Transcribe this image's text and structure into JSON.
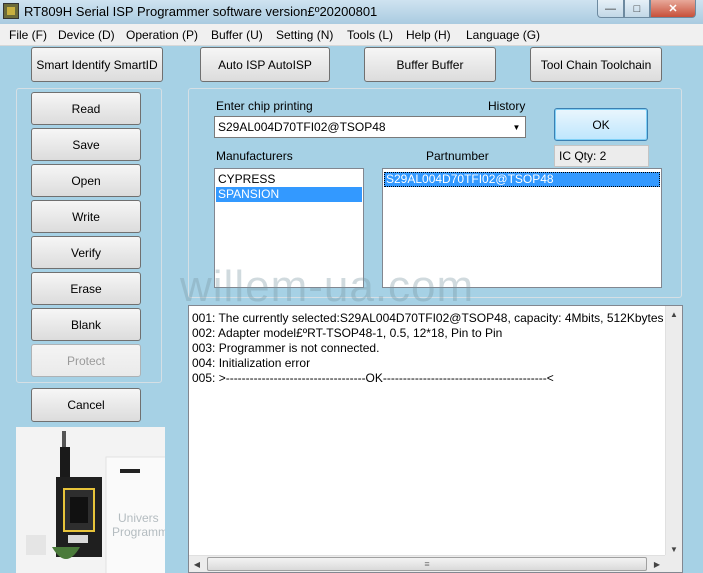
{
  "window": {
    "title": "RT809H Serial ISP Programmer software version£º20200801",
    "controls": {
      "minimize": "—",
      "maximize": "□",
      "close": "✕"
    }
  },
  "menu": [
    {
      "label": "File (F)"
    },
    {
      "label": "Device (D)"
    },
    {
      "label": "Operation (P)"
    },
    {
      "label": "Buffer (U)"
    },
    {
      "label": "Setting (N)"
    },
    {
      "label": "Tools (L)"
    },
    {
      "label": "Help (H)"
    },
    {
      "label": "Language (G)"
    }
  ],
  "toolbar": {
    "smart_identify": "Smart Identify SmartID",
    "auto_isp": "Auto ISP AutoISP",
    "buffer": "Buffer Buffer",
    "tool_chain": "Tool Chain Toolchain"
  },
  "operations": {
    "read": "Read",
    "save": "Save",
    "open": "Open",
    "write": "Write",
    "verify": "Verify",
    "erase": "Erase",
    "blank": "Blank",
    "protect": "Protect",
    "cancel": "Cancel"
  },
  "chip": {
    "enter_label": "Enter chip printing",
    "history_label": "History",
    "value": "S29AL004D70TFI02@TSOP48",
    "ok": "OK",
    "ic_qty": "IC Qty: 2",
    "manufacturers_label": "Manufacturers",
    "partnumber_label": "Partnumber",
    "manufacturers": [
      "CYPRESS",
      "SPANSION"
    ],
    "selected_manufacturer": "SPANSION",
    "partnumbers": [
      "S29AL004D70TFI02@TSOP48"
    ]
  },
  "log": [
    "001:  The currently selected:S29AL004D70TFI02@TSOP48, capacity: 4Mbits, 512Kbytes",
    "002:  Adapter model£ºRT-TSOP48-1, 0.5, 12*18, Pin to Pin",
    "003:  Programmer is not connected.",
    "004:  Initialization error",
    "005:  >-----------------------------------OK-----------------------------------------<"
  ],
  "watermark": "willem-ua.com",
  "photo": {
    "text_line1": "Univers",
    "text_line2": "Programm"
  },
  "colors": {
    "window_bg": "#a6d1e5",
    "selection": "#3399ff"
  }
}
